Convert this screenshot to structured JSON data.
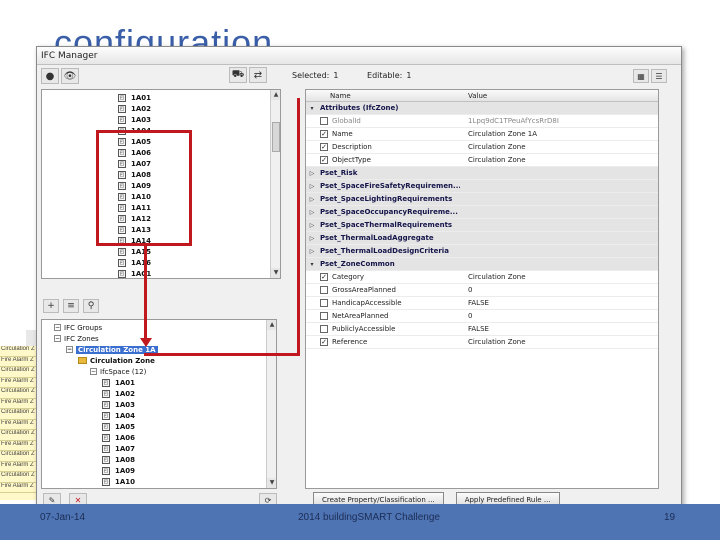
{
  "slide": {
    "title": "configuration",
    "footer_date": "07-Jan-14",
    "footer_center": "2014 buildingSMART Challenge",
    "footer_page": "19"
  },
  "background_table": {
    "header": "Name",
    "rows": [
      "Circulation Z",
      "Fire Alarm Z",
      "Circulation Z",
      "Fire Alarm Z",
      "Circulation Z",
      "Fire Alarm Z",
      "Circulation Z",
      "Fire Alarm Z",
      "Circulation Z",
      "Fire Alarm Z",
      "Circulation Z",
      "Fire Alarm Z",
      "Circulation Z",
      "Fire Alarm Z"
    ]
  },
  "window": {
    "title": "IFC Manager",
    "selected_label": "Selected:",
    "selected_value": "1",
    "editable_label": "Editable:",
    "editable_value": "1"
  },
  "top_tree": {
    "items": [
      "1A01",
      "1A02",
      "1A03",
      "1A04",
      "1A05",
      "1A06",
      "1A07",
      "1A08",
      "1A09",
      "1A10",
      "1A11",
      "1A12",
      "1A13",
      "1A14",
      "1A15",
      "1A16",
      "1AC1"
    ]
  },
  "bottom_tree": {
    "items": [
      {
        "label": "IFC Groups",
        "indent": 0,
        "type": "exp"
      },
      {
        "label": "IFC Zones",
        "indent": 0,
        "type": "exp"
      },
      {
        "label": "Circulation Zone 1A",
        "indent": 1,
        "type": "sel"
      },
      {
        "label": "Circulation Zone",
        "indent": 2,
        "type": "folder"
      },
      {
        "label": "IfcSpace (12)",
        "indent": 3,
        "type": "exp"
      },
      {
        "label": "1A01",
        "indent": 4,
        "type": "space"
      },
      {
        "label": "1A02",
        "indent": 4,
        "type": "space"
      },
      {
        "label": "1A03",
        "indent": 4,
        "type": "space"
      },
      {
        "label": "1A04",
        "indent": 4,
        "type": "space"
      },
      {
        "label": "1A05",
        "indent": 4,
        "type": "space"
      },
      {
        "label": "1A06",
        "indent": 4,
        "type": "space"
      },
      {
        "label": "1A07",
        "indent": 4,
        "type": "space"
      },
      {
        "label": "1A08",
        "indent": 4,
        "type": "space"
      },
      {
        "label": "1A09",
        "indent": 4,
        "type": "space"
      },
      {
        "label": "1A10",
        "indent": 4,
        "type": "space"
      }
    ]
  },
  "properties": {
    "col_name": "Name",
    "col_value": "Value",
    "rows": [
      {
        "kind": "group",
        "arrow": "v",
        "name": "Attributes (IfcZone)",
        "value": ""
      },
      {
        "kind": "row",
        "check": false,
        "dim": true,
        "name": "GlobalId",
        "value": "1Lpq9dC1TPeuAfYcsRrD8I"
      },
      {
        "kind": "row",
        "check": true,
        "name": "Name",
        "value": "Circulation Zone 1A"
      },
      {
        "kind": "row",
        "check": true,
        "name": "Description",
        "value": "Circulation Zone"
      },
      {
        "kind": "row",
        "check": true,
        "name": "ObjectType",
        "value": "Circulation Zone"
      },
      {
        "kind": "group",
        "arrow": "▷",
        "name": "Pset_Risk",
        "value": ""
      },
      {
        "kind": "group",
        "arrow": "▷",
        "name": "Pset_SpaceFireSafetyRequiremen...",
        "value": ""
      },
      {
        "kind": "group",
        "arrow": "▷",
        "name": "Pset_SpaceLightingRequirements",
        "value": ""
      },
      {
        "kind": "group",
        "arrow": "▷",
        "name": "Pset_SpaceOccupancyRequireme...",
        "value": ""
      },
      {
        "kind": "group",
        "arrow": "▷",
        "name": "Pset_SpaceThermalRequirements",
        "value": ""
      },
      {
        "kind": "group",
        "arrow": "▷",
        "name": "Pset_ThermalLoadAggregate",
        "value": ""
      },
      {
        "kind": "group",
        "arrow": "▷",
        "name": "Pset_ThermalLoadDesignCriteria",
        "value": ""
      },
      {
        "kind": "group",
        "arrow": "v",
        "name": "Pset_ZoneCommon",
        "value": ""
      },
      {
        "kind": "row",
        "check": true,
        "name": "Category",
        "value": "Circulation Zone"
      },
      {
        "kind": "row",
        "check": false,
        "name": "GrossAreaPlanned",
        "value": "0"
      },
      {
        "kind": "row",
        "check": false,
        "name": "HandicapAccessible",
        "value": "FALSE"
      },
      {
        "kind": "row",
        "check": false,
        "name": "NetAreaPlanned",
        "value": "0"
      },
      {
        "kind": "row",
        "check": false,
        "name": "PubliclyAccessible",
        "value": "FALSE"
      },
      {
        "kind": "row",
        "check": true,
        "name": "Reference",
        "value": "Circulation Zone"
      }
    ]
  },
  "buttons": {
    "create_property": "Create Property/Classification ...",
    "apply_rule": "Apply Predefined Rule ..."
  },
  "colors": {
    "highlight": "#c0181e",
    "accent": "#4f74b4"
  }
}
